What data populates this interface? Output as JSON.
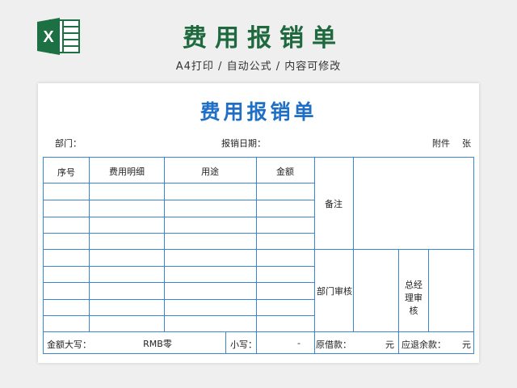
{
  "banner": {
    "title": "费用报销单",
    "subtitle": "A4打印 / 自动公式 / 内容可修改",
    "logo_icon": "excel-icon",
    "accent": "#1e6a3e"
  },
  "form": {
    "title": "费用报销单",
    "title_color": "#1f6fc6",
    "line_color": "#3a86d2",
    "meta": {
      "department": "部门：",
      "date": "报销日期：",
      "attachment": "附件",
      "sheets": "张"
    },
    "headers": {
      "seq": "序号",
      "detail": "费用明细",
      "purpose": "用途",
      "amount": "金额"
    },
    "remark_label": "备注",
    "dept_review": "部门审核",
    "gm_review": "总经理审核",
    "footer": {
      "amount_upper_label": "金额大写：",
      "amount_upper_value": "RMB零",
      "amount_lower_label": "小写：",
      "amount_lower_value": "-",
      "original_loan_label": "原借款：",
      "original_loan_unit": "元",
      "refund_label": "应退余款：",
      "refund_unit": "元"
    }
  }
}
